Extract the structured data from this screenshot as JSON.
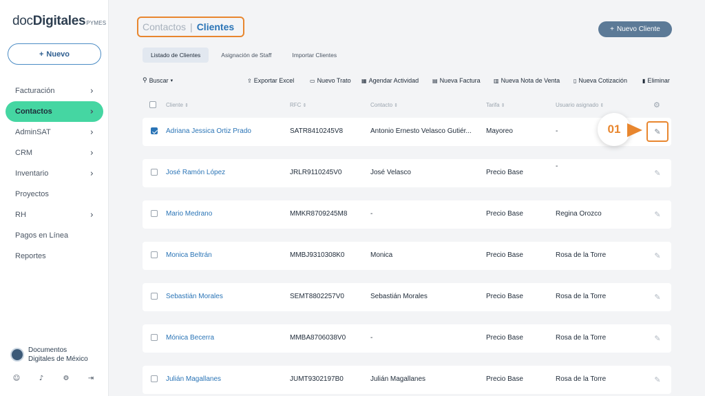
{
  "logo": {
    "part1": "doc",
    "part2": "Digitales",
    "part3": "PYMES"
  },
  "sidebar": {
    "new_label": "Nuevo",
    "items": [
      {
        "label": "Facturación",
        "chevron": true,
        "active": false
      },
      {
        "label": "Contactos",
        "chevron": true,
        "active": true
      },
      {
        "label": "AdminSAT",
        "chevron": true,
        "active": false
      },
      {
        "label": "CRM",
        "chevron": true,
        "active": false
      },
      {
        "label": "Inventario",
        "chevron": true,
        "active": false
      },
      {
        "label": "Proyectos",
        "chevron": false,
        "active": false
      },
      {
        "label": "RH",
        "chevron": true,
        "active": false
      },
      {
        "label": "Pagos en Línea",
        "chevron": false,
        "active": false
      },
      {
        "label": "Reportes",
        "chevron": false,
        "active": false
      }
    ],
    "company_line1": "Documentos",
    "company_line2": "Digitales de México"
  },
  "header": {
    "title_part1": "Contactos",
    "title_sep": "|",
    "title_part2": "Clientes",
    "new_client_label": "Nuevo Cliente"
  },
  "tabs": [
    {
      "label": "Listado de Clientes",
      "active": true
    },
    {
      "label": "Asignación de Staff",
      "active": false
    },
    {
      "label": "Importar Clientes",
      "active": false
    }
  ],
  "toolbar": {
    "search_label": "Buscar",
    "actions": [
      {
        "label": "Exportar Excel",
        "icon": "export-icon"
      },
      {
        "label": "Nuevo Trato",
        "icon": "deal-icon"
      },
      {
        "label": "Agendar Actividad",
        "icon": "calendar-icon"
      },
      {
        "label": "Nueva Factura",
        "icon": "invoice-icon"
      },
      {
        "label": "Nueva Nota de Venta",
        "icon": "note-icon"
      },
      {
        "label": "Nueva Cotización",
        "icon": "quote-icon"
      },
      {
        "label": "Eliminar",
        "icon": "trash-icon"
      }
    ]
  },
  "table": {
    "headers": [
      "Cliente",
      "RFC",
      "Contacto",
      "Tarifa",
      "Usuario asignado"
    ],
    "rows": [
      {
        "checked": true,
        "cliente": "Adriana Jessica Ortiz Prado",
        "rfc": "SATR8410245V8",
        "contacto": "Antonio Ernesto Velasco Gutiér...",
        "tarifa": "Mayoreo",
        "usuario": "-"
      },
      {
        "checked": false,
        "cliente": "José Ramón López",
        "rfc": "JRLR9110245V0",
        "contacto": "José Velasco",
        "tarifa": "Precio Base",
        "usuario": "-"
      },
      {
        "checked": false,
        "cliente": "Mario Medrano",
        "rfc": "MMKR8709245M8",
        "contacto": "-",
        "tarifa": "Precio Base",
        "usuario": "Regina Orozco"
      },
      {
        "checked": false,
        "cliente": "Monica Beltrán",
        "rfc": "MMBJ9310308K0",
        "contacto": "Monica",
        "tarifa": "Precio Base",
        "usuario": "Rosa de la Torre"
      },
      {
        "checked": false,
        "cliente": "Sebastián Morales",
        "rfc": "SEMT8802257V0",
        "contacto": "Sebastián Morales",
        "tarifa": "Precio Base",
        "usuario": "Rosa de la Torre"
      },
      {
        "checked": false,
        "cliente": "Mónica Becerra",
        "rfc": "MMBA8706038V0",
        "contacto": "-",
        "tarifa": "Precio Base",
        "usuario": "Rosa de la Torre"
      },
      {
        "checked": false,
        "cliente": "Julián Magallanes",
        "rfc": "JUMT9302197B0",
        "contacto": "Julián Magallanes",
        "tarifa": "Precio Base",
        "usuario": "Rosa de la Torre"
      }
    ]
  },
  "step": {
    "label": "01"
  },
  "colors": {
    "accent": "#e8862e",
    "link": "#2a74b6",
    "active_nav": "#45d6a2",
    "button": "#5c7a97"
  }
}
